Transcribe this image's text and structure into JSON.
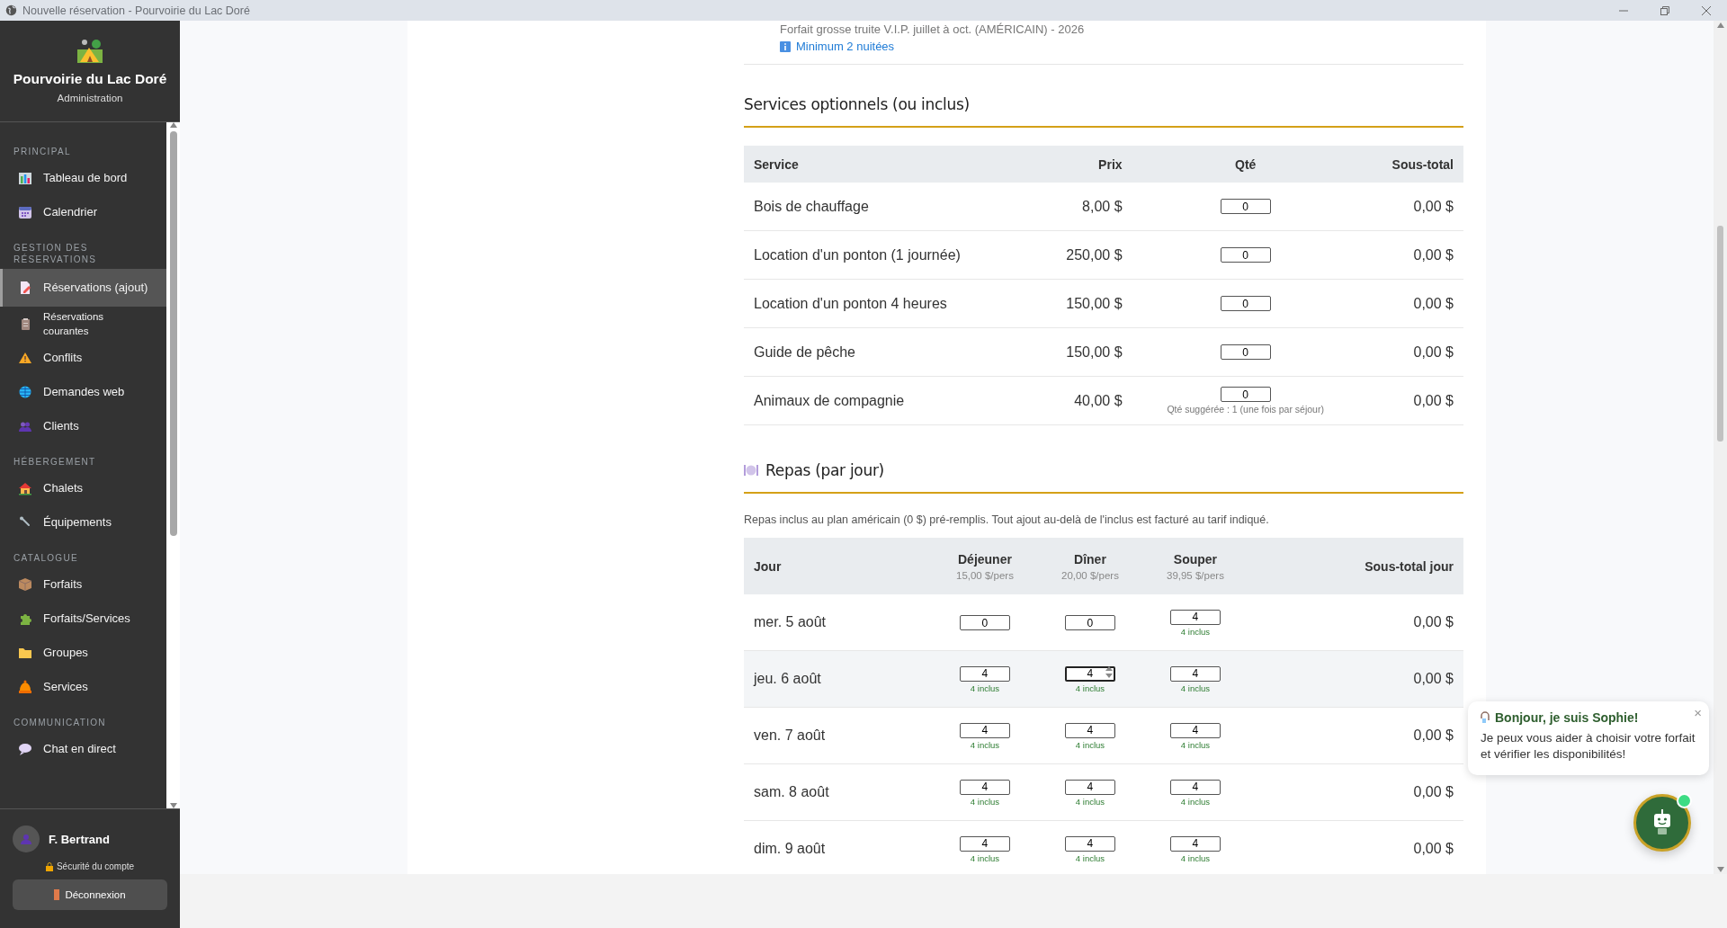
{
  "window": {
    "title": "Nouvelle réservation - Pourvoirie du Lac Doré"
  },
  "sidebar": {
    "brand": "Pourvoirie du Lac Doré",
    "subtitle": "Administration",
    "sections": [
      {
        "label": "PRINCIPAL",
        "items": [
          {
            "label": "Tableau de bord",
            "kind": "chart",
            "selected": false
          },
          {
            "label": "Calendrier",
            "kind": "calendar",
            "selected": false
          }
        ]
      },
      {
        "label": "GESTION DES RÉSERVATIONS",
        "items": [
          {
            "label": "Réservations (ajout)",
            "kind": "document",
            "selected": true
          },
          {
            "label": "Réservations courantes",
            "kind": "clipboard",
            "selected": false
          },
          {
            "label": "Conflits",
            "kind": "warning",
            "selected": false
          },
          {
            "label": "Demandes web",
            "kind": "globe",
            "selected": false
          },
          {
            "label": "Clients",
            "kind": "people",
            "selected": false
          }
        ]
      },
      {
        "label": "HÉBERGEMENT",
        "items": [
          {
            "label": "Chalets",
            "kind": "house",
            "selected": false
          },
          {
            "label": "Équipements",
            "kind": "wrench",
            "selected": false
          }
        ]
      },
      {
        "label": "CATALOGUE",
        "items": [
          {
            "label": "Forfaits",
            "kind": "box",
            "selected": false
          },
          {
            "label": "Forfaits/Services",
            "kind": "puzzle",
            "selected": false
          },
          {
            "label": "Groupes",
            "kind": "folder",
            "selected": false
          },
          {
            "label": "Services",
            "kind": "bell",
            "selected": false
          }
        ]
      },
      {
        "label": "COMMUNICATION",
        "items": [
          {
            "label": "Chat en direct",
            "kind": "speech",
            "selected": false
          }
        ]
      }
    ],
    "user": {
      "name": "F. Bertrand"
    },
    "security_link": "Sécurité du compte",
    "logout_button": "Déconnexion"
  },
  "package": {
    "name": "Forfait grosse truite V.I.P. juillet à oct. (AMÉRICAIN) - 2026",
    "notice": "Minimum 2 nuitées"
  },
  "services": {
    "title": "Services optionnels (ou inclus)",
    "columns": [
      "Service",
      "Prix",
      "Qté",
      "Sous-total"
    ],
    "rows": [
      {
        "service": "Bois de chauffage",
        "price": "8,00 $",
        "qty": "0",
        "subtotal": "0,00 $"
      },
      {
        "service": "Location d'un ponton (1 journée)",
        "price": "250,00 $",
        "qty": "0",
        "subtotal": "0,00 $"
      },
      {
        "service": "Location d'un ponton 4 heures",
        "price": "150,00 $",
        "qty": "0",
        "subtotal": "0,00 $"
      },
      {
        "service": "Guide de pêche",
        "price": "150,00 $",
        "qty": "0",
        "subtotal": "0,00 $"
      },
      {
        "service": "Animaux de compagnie",
        "price": "40,00 $",
        "qty": "0",
        "subtotal": "0,00 $",
        "hint": "Qté suggérée : 1 (une fois par séjour)"
      }
    ]
  },
  "meals": {
    "title": "Repas (par jour)",
    "note": "Repas inclus au plan américain (0 $) pré-remplis. Tout ajout au-delà de l'inclus est facturé au tarif indiqué.",
    "columns": [
      {
        "label": "Jour"
      },
      {
        "label": "Déjeuner",
        "rate": "15,00 $/pers"
      },
      {
        "label": "Dîner",
        "rate": "20,00 $/pers"
      },
      {
        "label": "Souper",
        "rate": "39,95 $/pers"
      },
      {
        "label": "Sous-total jour"
      }
    ],
    "rows": [
      {
        "highlighted": false,
        "cells": [
          {
            "kind": "text",
            "text": "mer. 5 août"
          },
          {
            "kind": "qty",
            "value": "0",
            "focused": false
          },
          {
            "kind": "qty",
            "value": "0",
            "focused": false
          },
          {
            "kind": "qty",
            "value": "4",
            "included": "4 inclus",
            "focused": false
          },
          {
            "kind": "amount",
            "text": "0,00 $"
          }
        ]
      },
      {
        "highlighted": true,
        "cells": [
          {
            "kind": "text",
            "text": "jeu. 6 août"
          },
          {
            "kind": "qty",
            "value": "4",
            "included": "4 inclus",
            "focused": false
          },
          {
            "kind": "qty",
            "value": "4",
            "included": "4 inclus",
            "focused": true
          },
          {
            "kind": "qty",
            "value": "4",
            "included": "4 inclus",
            "focused": false
          },
          {
            "kind": "amount",
            "text": "0,00 $"
          }
        ]
      },
      {
        "highlighted": false,
        "cells": [
          {
            "kind": "text",
            "text": "ven. 7 août"
          },
          {
            "kind": "qty",
            "value": "4",
            "included": "4 inclus",
            "focused": false
          },
          {
            "kind": "qty",
            "value": "4",
            "included": "4 inclus",
            "focused": false
          },
          {
            "kind": "qty",
            "value": "4",
            "included": "4 inclus",
            "focused": false
          },
          {
            "kind": "amount",
            "text": "0,00 $"
          }
        ]
      },
      {
        "highlighted": false,
        "cells": [
          {
            "kind": "text",
            "text": "sam. 8 août"
          },
          {
            "kind": "qty",
            "value": "4",
            "included": "4 inclus",
            "focused": false
          },
          {
            "kind": "qty",
            "value": "4",
            "included": "4 inclus",
            "focused": false
          },
          {
            "kind": "qty",
            "value": "4",
            "included": "4 inclus",
            "focused": false
          },
          {
            "kind": "amount",
            "text": "0,00 $"
          }
        ]
      },
      {
        "highlighted": false,
        "cells": [
          {
            "kind": "text",
            "text": "dim. 9 août"
          },
          {
            "kind": "qty",
            "value": "4",
            "included": "4 inclus",
            "focused": false
          },
          {
            "kind": "qty",
            "value": "4",
            "included": "4 inclus",
            "focused": false
          },
          {
            "kind": "qty",
            "value": "4",
            "included": "4 inclus",
            "focused": false
          },
          {
            "kind": "amount",
            "text": "0,00 $"
          }
        ]
      }
    ]
  },
  "chat": {
    "greeting": "Bonjour, je suis Sophie!",
    "message": "Je peux vous aider à choisir votre forfait et vérifier les disponibilités!",
    "close": "×",
    "online": true
  }
}
